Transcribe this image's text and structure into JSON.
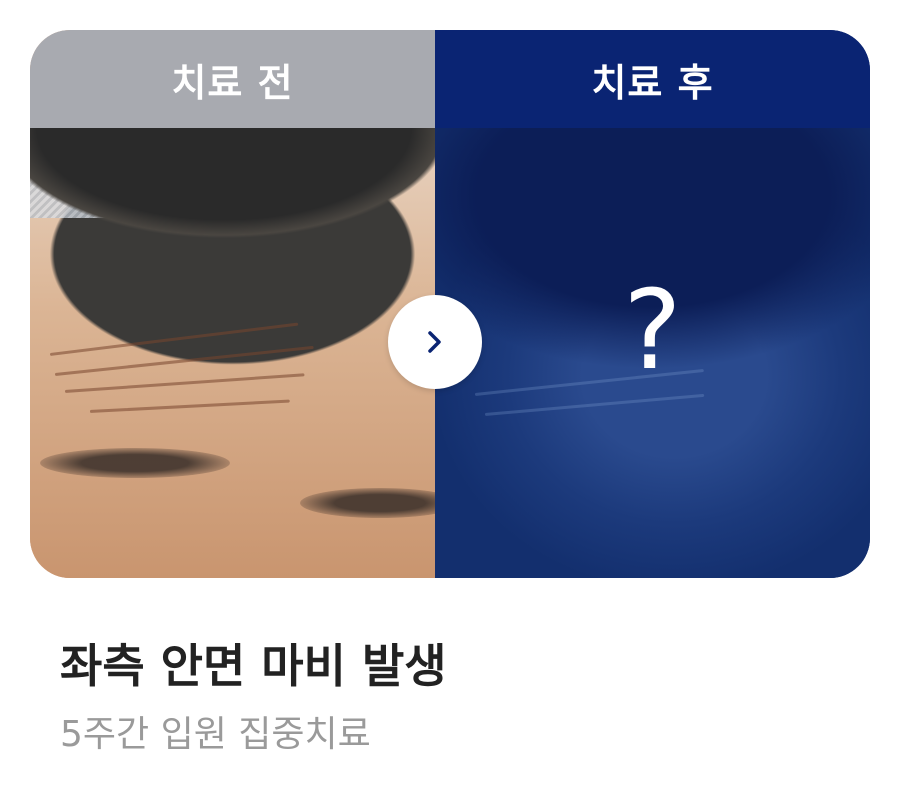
{
  "comparison": {
    "before": {
      "label": "치료 전"
    },
    "after": {
      "label": "치료 후",
      "placeholder_symbol": "?"
    },
    "next_icon": "chevron-right-icon"
  },
  "colors": {
    "before_header": "#a8aab0",
    "after_header": "#0a2473",
    "after_overlay": "#13306f",
    "title_text": "#222222",
    "subtitle_text": "#9a9a9a"
  },
  "case": {
    "title": "좌측 안면 마비 발생",
    "subtitle": "5주간 입원 집중치료"
  }
}
